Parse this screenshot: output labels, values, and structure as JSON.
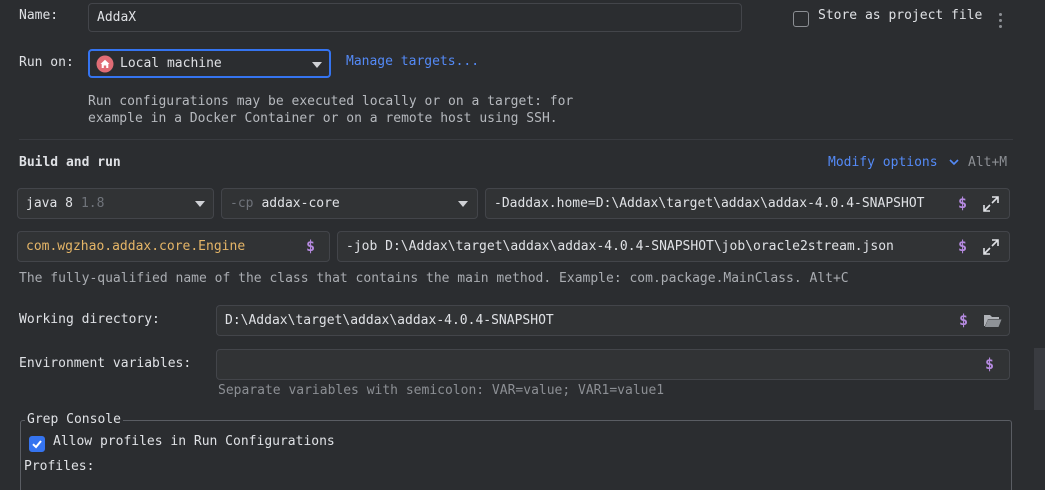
{
  "name": {
    "label": "Name:",
    "value": "AddaX"
  },
  "store_project": {
    "label": "Store as project file",
    "checked": false
  },
  "run_on": {
    "label": "Run on:",
    "selected": "Local machine",
    "manage_link": "Manage targets..."
  },
  "run_hint": {
    "line1": "Run configurations may be executed locally or on a target: for",
    "line2": "example in a Docker Container or on a remote host using SSH."
  },
  "build_run": {
    "title": "Build and run",
    "modify_options": "Modify options",
    "modify_shortcut": "Alt+M",
    "jdk": {
      "name": "java 8",
      "version": "1.8"
    },
    "classpath": {
      "prefix": "-cp",
      "module": "addax-core"
    },
    "vm_options": "-Daddax.home=D:\\Addax\\target\\addax\\addax-4.0.4-SNAPSHOT",
    "main_class": "com.wgzhao.addax.core.Engine",
    "program_args": "-job D:\\Addax\\target\\addax\\addax-4.0.4-SNAPSHOT\\job\\oracle2stream.json",
    "main_class_hint": "The fully-qualified name of the class that contains the main method. Example: com.package.MainClass. Alt+C"
  },
  "working_dir": {
    "label": "Working directory:",
    "value": "D:\\Addax\\target\\addax\\addax-4.0.4-SNAPSHOT"
  },
  "env_vars": {
    "label": "Environment variables:",
    "value": "",
    "hint": "Separate variables with semicolon: VAR=value; VAR1=value1"
  },
  "grep_console": {
    "title": "Grep Console",
    "allow_profiles": {
      "label": "Allow profiles in Run Configurations",
      "checked": true
    },
    "profiles_label": "Profiles:"
  },
  "macro_symbol": "$",
  "colors": {
    "accent": "#3574f0",
    "link": "#548af7",
    "macro": "#b58ae0",
    "class_name": "#e5b567",
    "home_icon": "#e06c75"
  }
}
